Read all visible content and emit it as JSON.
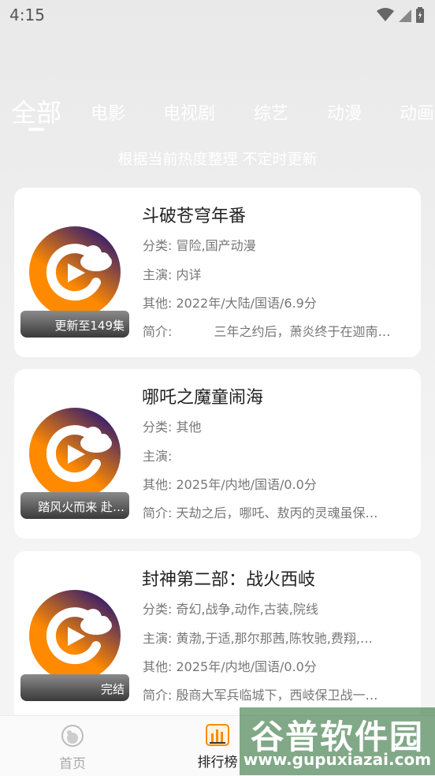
{
  "status_bar": {
    "time": "4:15"
  },
  "tabs": [
    {
      "label": "全部",
      "active": true
    },
    {
      "label": "电影"
    },
    {
      "label": "电视剧"
    },
    {
      "label": "综艺"
    },
    {
      "label": "动漫"
    },
    {
      "label": "动画"
    }
  ],
  "subtitle": "根据当前热度整理 不定时更新",
  "items": [
    {
      "title": "斗破苍穹年番",
      "badge": "更新至149集",
      "category_label": "分类:",
      "category": "冒险,国产动漫",
      "cast_label": "主演:",
      "cast": "内详",
      "other_label": "其他:",
      "other": "2022年/大陆/国语/6.9分",
      "intro_label": "简介:",
      "intro": "　　　三年之约后，萧炎终于在迦南…"
    },
    {
      "title": "哪吒之魔童闹海",
      "badge": "踏风火而来 赴…",
      "category_label": "分类:",
      "category": "其他",
      "cast_label": "主演:",
      "cast": "",
      "other_label": "其他:",
      "other": "2025年/内地/国语/0.0分",
      "intro_label": "简介:",
      "intro": "天劫之后，哪吒、敖丙的灵魂虽保…"
    },
    {
      "title": "封神第二部：战火西岐",
      "badge": "完结",
      "category_label": "分类:",
      "category": "奇幻,战争,动作,古装,院线",
      "cast_label": "主演:",
      "cast": "黄渤,于适,那尔那茜,陈牧驰,费翔,…",
      "other_label": "其他:",
      "other": "2025年/内地/国语/0.0分",
      "intro_label": "简介:",
      "intro": "殷商大军兵临城下，西岐保卫战一…"
    }
  ],
  "bottom_nav": [
    {
      "label": "首页",
      "icon": "home-icon",
      "active": false
    },
    {
      "label": "排行榜",
      "icon": "ranking-icon",
      "active": true
    }
  ],
  "watermark": {
    "title": "谷普软件园",
    "url": "www.gupuxiazai.com"
  },
  "colors": {
    "accent": "#ff8a00",
    "poster_dark": "#3a1f6b",
    "badge": "#5a5a5a"
  }
}
